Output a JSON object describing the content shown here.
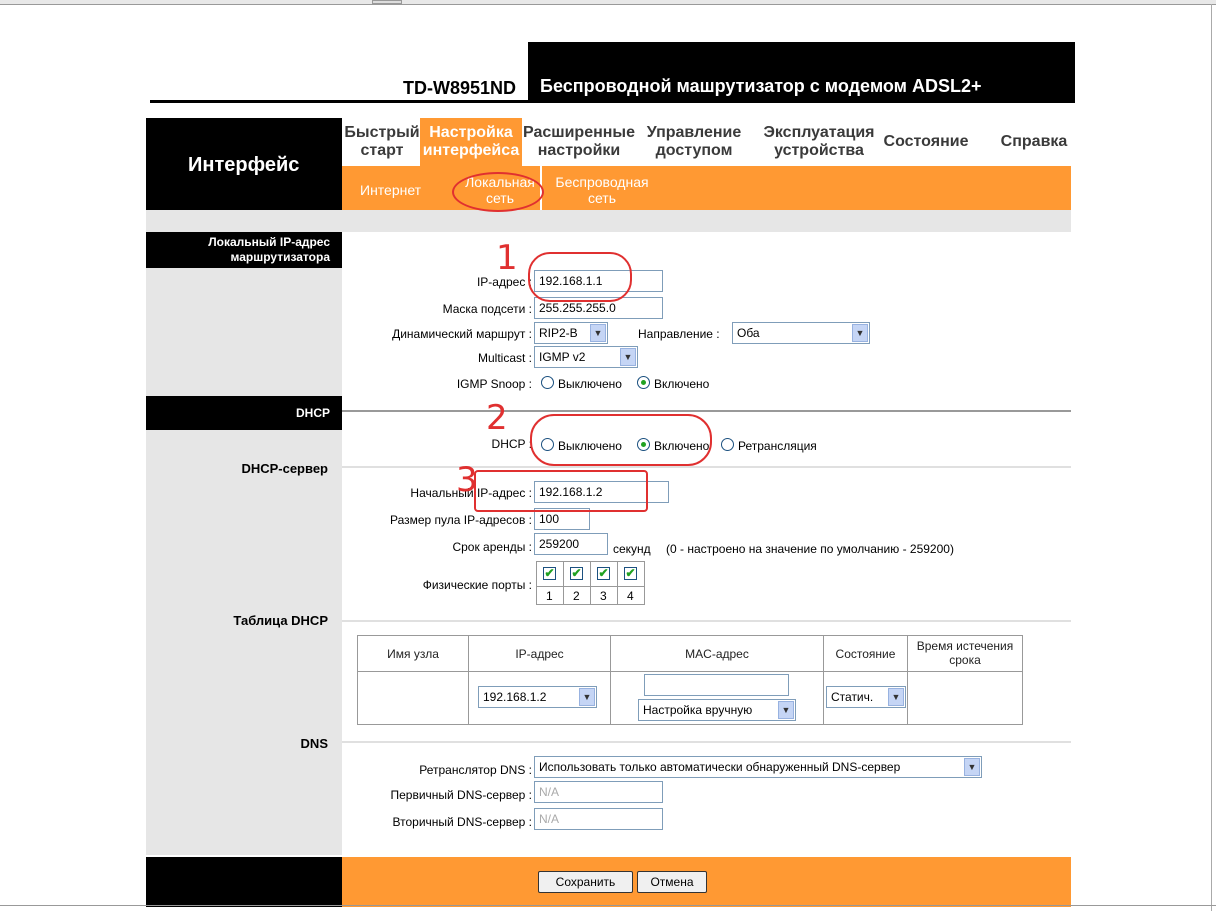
{
  "header": {
    "model": "TD-W8951ND",
    "title": "Беспроводной машрутизатор с модемом ADSL2+",
    "section": "Интерфейс"
  },
  "nav": {
    "items": [
      {
        "line1": "Быстрый",
        "line2": "старт"
      },
      {
        "line1": "Настройка",
        "line2": "интерфейса"
      },
      {
        "line1": "Расширенные",
        "line2": "настройки"
      },
      {
        "line1": "Управление",
        "line2": "доступом"
      },
      {
        "line1": "Эксплуатация",
        "line2": "устройства"
      },
      {
        "line1": "Состояние",
        "line2": ""
      },
      {
        "line1": "Справка",
        "line2": ""
      }
    ],
    "active": "Настройка интерфейса"
  },
  "subnav": {
    "internet": "Интернет",
    "lan": {
      "line1": "Локальная",
      "line2": "сеть"
    },
    "wireless": {
      "line1": "Беспроводная",
      "line2": "сеть"
    }
  },
  "lan_section": {
    "title_line1": "Локальный IP-адрес",
    "title_line2": "маршрутизатора",
    "ip_label": "IP-адрес :",
    "ip_value": "192.168.1.1",
    "mask_label": "Маска подсети :",
    "mask_value": "255.255.255.0",
    "route_label": "Динамический маршрут :",
    "route_value": "RIP2-B",
    "direction_label": "Направление :",
    "direction_value": "Оба",
    "multicast_label": "Multicast :",
    "multicast_value": "IGMP v2",
    "igmp_label": "IGMP Snoop :",
    "igmp_off": "Выключено",
    "igmp_on": "Включено",
    "igmp_selected": "Включено"
  },
  "dhcp_section": {
    "title": "DHCP",
    "dhcp_label": "DHCP :",
    "opt_off": "Выключено",
    "opt_on": "Включено",
    "opt_relay": "Ретрансляция",
    "selected": "Включено",
    "server_title": "DHCP-сервер",
    "start_label": "Начальный IP-адрес :",
    "start_value": "192.168.1.2",
    "pool_label": "Размер пула IP-адресов :",
    "pool_value": "100",
    "lease_label": "Срок аренды :",
    "lease_value": "259200",
    "lease_unit": "секунд",
    "lease_note": "(0 - настроено на значение по умолчанию - 259200)",
    "ports_label": "Физические порты :",
    "ports": [
      "1",
      "2",
      "3",
      "4"
    ],
    "port_checked": "✔"
  },
  "dhcp_table": {
    "title": "Таблица DHCP",
    "headers": [
      "Имя узла",
      "IP-адрес",
      "MAC-адрес",
      "Состояние"
    ],
    "expire_line1": "Время истечения",
    "expire_line2": "срока",
    "ip_select": "192.168.1.2",
    "mac_value": "",
    "mac_mode": "Настройка вручную",
    "state_select": "Статич."
  },
  "dns_section": {
    "title": "DNS",
    "relay_label": "Ретранслятор DNS :",
    "relay_value": "Использовать только автоматически обнаруженный DNS-сервер",
    "primary_label": "Первичный DNS-сервер :",
    "primary_value": "N/A",
    "secondary_label": "Вторичный DNS-сервер :",
    "secondary_value": "N/A"
  },
  "footer": {
    "save": "Сохранить",
    "cancel": "Отмена"
  },
  "annotations": {
    "n1": "1",
    "n2": "2",
    "n3": "3"
  },
  "icons": {
    "dropdown": "chevron-down-icon"
  },
  "colors": {
    "orange": "#ff9933",
    "black": "#000000",
    "gray": "#e6e6e6",
    "annotation_red": "#e03030"
  }
}
